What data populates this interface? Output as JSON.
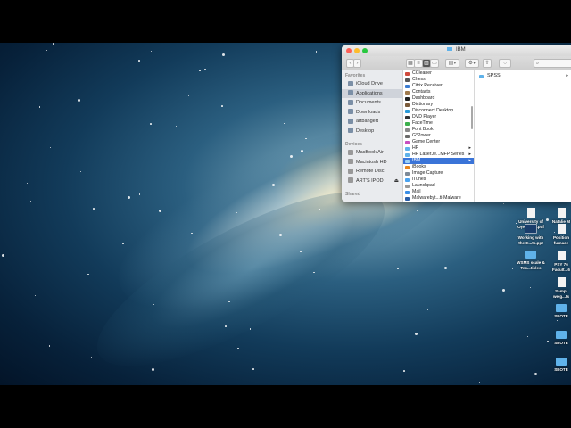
{
  "window": {
    "title": "IBM"
  },
  "sidebar": {
    "favorites_label": "Favorites",
    "favorites": [
      "iCloud Drive",
      "Applications",
      "Documents",
      "Downloads",
      "artbangert",
      "Desktop"
    ],
    "devices_label": "Devices",
    "devices": [
      "MacBook Air",
      "Macintosh HD",
      "Remote Disc",
      "ART'S IPOD"
    ],
    "shared_label": "Shared"
  },
  "apps": [
    "CCleaner",
    "Chess",
    "Citrix Receiver",
    "Contacts",
    "Dashboard",
    "Dictionary",
    "Disconnect Desktop",
    "DVD Player",
    "FaceTime",
    "Font Book",
    "G*Power",
    "Game Center",
    "HP",
    "HP LaserJe...MFP Series",
    "IBM",
    "iBooks",
    "Image Capture",
    "iTunes",
    "Launchpad",
    "Mail",
    "Malwarebyt...ti-Malware"
  ],
  "selected_app": "IBM",
  "ibm_contents": [
    "SPSS"
  ],
  "desktop": [
    {
      "label": "University of Oreg....od.pdf"
    },
    {
      "label": "Natalie M"
    },
    {
      "label": "Working with the E...ts.ppt"
    },
    {
      "label": "Position furnace"
    },
    {
      "label": "WSMS scale & Tec...ticles"
    },
    {
      "label": "PSY 76 Facult...6"
    },
    {
      "label": "Sampl welg...ts"
    },
    {
      "label": "SEOTE"
    },
    {
      "label": "SEOTE"
    },
    {
      "label": "SEOTE"
    }
  ],
  "colors": {
    "selection": "#3a74d8",
    "folder": "#5fb2ea"
  }
}
